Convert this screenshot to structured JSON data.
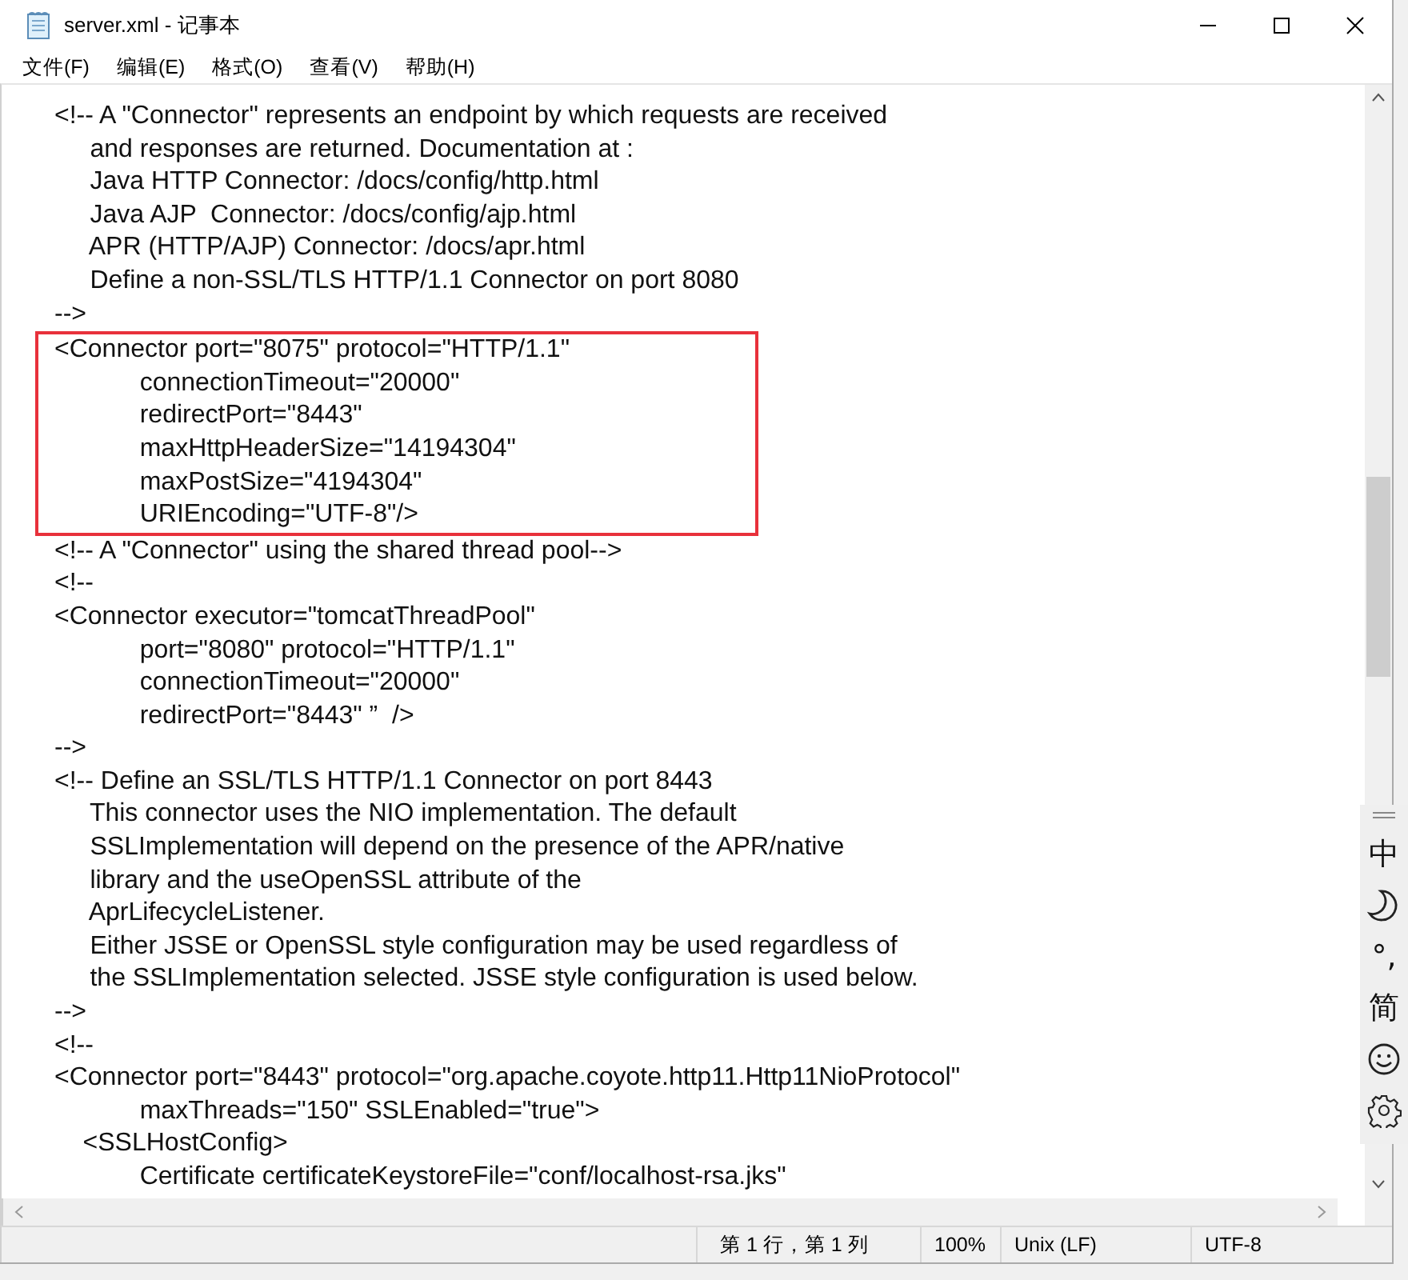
{
  "window": {
    "title": "server.xml - 记事本"
  },
  "menu": [
    "文件(F)",
    "编辑(E)",
    "格式(O)",
    "查看(V)",
    "帮助(H)"
  ],
  "editor": {
    "lines": [
      {
        "text": "<!-- A \"Connector\" represents an endpoint by which requests are received",
        "highlighted": false
      },
      {
        "text": "     and responses are returned. Documentation at :",
        "highlighted": false
      },
      {
        "text": "     Java HTTP Connector: /docs/config/http.html",
        "highlighted": false
      },
      {
        "text": "     Java AJP  Connector: /docs/config/ajp.html",
        "highlighted": false
      },
      {
        "text": "     APR (HTTP/AJP) Connector: /docs/apr.html",
        "highlighted": false
      },
      {
        "text": "     Define a non-SSL/TLS HTTP/1.1 Connector on port 8080",
        "highlighted": false
      },
      {
        "text": "-->",
        "highlighted": false
      },
      {
        "text": "<Connector port=\"8075\" protocol=\"HTTP/1.1\"",
        "highlighted": true
      },
      {
        "text": "            connectionTimeout=\"20000\"",
        "highlighted": true
      },
      {
        "text": "            redirectPort=\"8443\"",
        "highlighted": true
      },
      {
        "text": "            maxHttpHeaderSize=\"14194304\"",
        "highlighted": true
      },
      {
        "text": "            maxPostSize=\"4194304\"",
        "highlighted": true
      },
      {
        "text": "            URIEncoding=\"UTF-8\"/>",
        "highlighted": true
      },
      {
        "text": "<!-- A \"Connector\" using the shared thread pool-->",
        "highlighted": false
      },
      {
        "text": "<!--",
        "highlighted": false
      },
      {
        "text": "<Connector executor=\"tomcatThreadPool\"",
        "highlighted": false
      },
      {
        "text": "            port=\"8080\" protocol=\"HTTP/1.1\"",
        "highlighted": false
      },
      {
        "text": "            connectionTimeout=\"20000\"",
        "highlighted": false
      },
      {
        "text": "            redirectPort=\"8443\" ”  />",
        "highlighted": false
      },
      {
        "text": "-->",
        "highlighted": false
      },
      {
        "text": "<!-- Define an SSL/TLS HTTP/1.1 Connector on port 8443",
        "highlighted": false
      },
      {
        "text": "     This connector uses the NIO implementation. The default",
        "highlighted": false
      },
      {
        "text": "     SSLImplementation will depend on the presence of the APR/native",
        "highlighted": false
      },
      {
        "text": "     library and the useOpenSSL attribute of the",
        "highlighted": false
      },
      {
        "text": "     AprLifecycleListener.",
        "highlighted": false
      },
      {
        "text": "     Either JSSE or OpenSSL style configuration may be used regardless of",
        "highlighted": false
      },
      {
        "text": "     the SSLImplementation selected. JSSE style configuration is used below.",
        "highlighted": false
      },
      {
        "text": "-->",
        "highlighted": false
      },
      {
        "text": "<!--",
        "highlighted": false
      },
      {
        "text": "<Connector port=\"8443\" protocol=\"org.apache.coyote.http11.Http11NioProtocol\"",
        "highlighted": false
      },
      {
        "text": "            maxThreads=\"150\" SSLEnabled=\"true\">",
        "highlighted": false
      },
      {
        "text": "    <SSLHostConfig>",
        "highlighted": false
      },
      {
        "text": "            Certificate certificateKeystoreFile=\"conf/localhost-rsa.jks\"",
        "highlighted": false
      }
    ]
  },
  "ime_toolbar": [
    {
      "kind": "text",
      "label": "中"
    },
    {
      "kind": "moon"
    },
    {
      "kind": "text",
      "label": "°,"
    },
    {
      "kind": "text",
      "label": "简"
    },
    {
      "kind": "smiley"
    },
    {
      "kind": "gear"
    }
  ],
  "status_bar": {
    "position": "第 1 行，第 1 列",
    "zoom": "100%",
    "line_ending": "Unix (LF)",
    "encoding": "UTF-8"
  }
}
